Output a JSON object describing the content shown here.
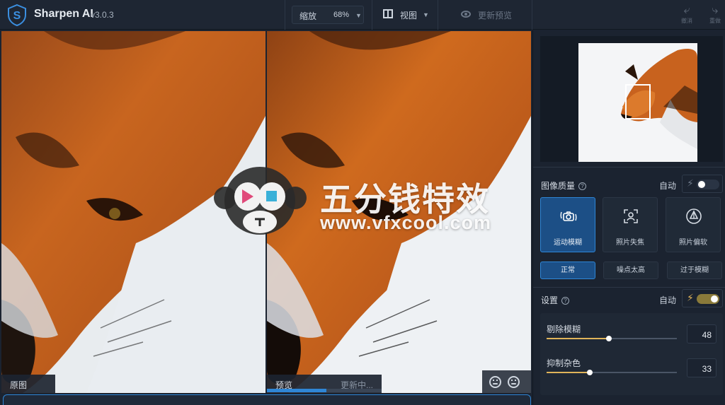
{
  "app": {
    "name": "Sharpen AI",
    "version": "v3.0.3"
  },
  "toolbar": {
    "zoom_label": "缩放",
    "zoom_value": "68%",
    "view_label": "视图",
    "update_preview_label": "更新预览",
    "undo_label": "撤消",
    "redo_label": "重做"
  },
  "panes": {
    "original_label": "原图",
    "preview_label": "预览",
    "preview_status": "更新中...",
    "progress": 0.52
  },
  "watermark": {
    "title": "五分钱特效",
    "url": "www.vfxcool.com"
  },
  "side": {
    "image_quality": {
      "title": "图像质量",
      "auto_label": "自动",
      "auto_on": false,
      "modes": [
        {
          "label": "运动模糊",
          "icon": "motion-blur-camera-icon",
          "active": true
        },
        {
          "label": "照片失焦",
          "icon": "focus-frame-person-icon",
          "active": false
        },
        {
          "label": "照片偏软",
          "icon": "soft-drop-icon",
          "active": false
        }
      ],
      "levels": [
        {
          "label": "正常",
          "active": true
        },
        {
          "label": "噪点太高",
          "active": false
        },
        {
          "label": "过于模糊",
          "active": false
        }
      ]
    },
    "settings": {
      "title": "设置",
      "auto_label": "自动",
      "auto_on": true,
      "sliders": [
        {
          "label": "剔除模糊",
          "value": 48
        },
        {
          "label": "抑制杂色",
          "value": 33
        }
      ]
    }
  },
  "colors": {
    "accent": "#2f86d6",
    "active_bg": "#1c4f86",
    "slider": "#e0b45a",
    "toggle_on": "#8a7a3a"
  }
}
